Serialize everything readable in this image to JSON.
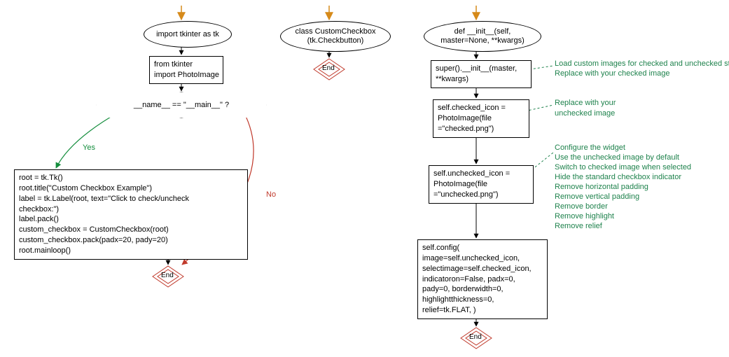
{
  "chart_data": {
    "type": "flowchart",
    "lanes": [
      {
        "id": "main",
        "nodes": [
          {
            "id": "n_import_tk",
            "shape": "ellipse",
            "text": "import tkinter as tk"
          },
          {
            "id": "n_import_photo",
            "shape": "box",
            "text": "from tkinter\nimport PhotoImage"
          },
          {
            "id": "n_main_test",
            "shape": "diamond",
            "text": "__name__ == \"__main__\" ?"
          },
          {
            "id": "n_main_block",
            "shape": "box",
            "text": "root = tk.Tk()\nroot.title(\"Custom Checkbox Example\")\nlabel = tk.Label(root, text=\"Click to check/uncheck\ncheckbox:\")\nlabel.pack()\ncustom_checkbox = CustomCheckbox(root)\ncustom_checkbox.pack(padx=20, pady=20)\nroot.mainloop()"
          },
          {
            "id": "n_end_main",
            "shape": "end",
            "text": "End"
          }
        ],
        "edges": [
          {
            "from": "start",
            "to": "n_import_tk",
            "color": "#d68a1a"
          },
          {
            "from": "n_import_tk",
            "to": "n_import_photo",
            "color": "#000000"
          },
          {
            "from": "n_import_photo",
            "to": "n_main_test",
            "color": "#000000"
          },
          {
            "from": "n_main_test",
            "to": "n_main_block",
            "label": "Yes",
            "color": "#138d3c"
          },
          {
            "from": "n_main_test",
            "to": "n_end_main",
            "label": "No",
            "color": "#c0392b"
          },
          {
            "from": "n_main_block",
            "to": "n_end_main",
            "color": "#000000"
          }
        ]
      },
      {
        "id": "class",
        "nodes": [
          {
            "id": "n_class",
            "shape": "ellipse",
            "text": "class CustomCheckbox\n(tk.Checkbutton)"
          },
          {
            "id": "n_end_class",
            "shape": "end",
            "text": "End"
          }
        ],
        "edges": [
          {
            "from": "start",
            "to": "n_class",
            "color": "#d68a1a"
          },
          {
            "from": "n_class",
            "to": "n_end_class",
            "color": "#000000"
          }
        ]
      },
      {
        "id": "init",
        "nodes": [
          {
            "id": "n_def_init",
            "shape": "ellipse",
            "text": "def __init__(self,\nmaster=None, **kwargs)"
          },
          {
            "id": "n_super",
            "shape": "box",
            "text": "super().__init__(master,\n**kwargs)",
            "comments": [
              "Load custom images for checked and unchecked states",
              "Replace with your checked image"
            ]
          },
          {
            "id": "n_checked",
            "shape": "box",
            "text": "self.checked_icon =\nPhotoImage(file\n=\"checked.png\")",
            "comments": [
              "Replace with your\nunchecked image"
            ]
          },
          {
            "id": "n_unchecked",
            "shape": "box",
            "text": "self.unchecked_icon =\nPhotoImage(file\n=\"unchecked.png\")",
            "comments": [
              "Configure the widget",
              "Use the unchecked image by default",
              "Switch to checked image when selected",
              "Hide the standard checkbox indicator",
              "Remove horizontal padding",
              "Remove vertical padding",
              "Remove border",
              "Remove highlight",
              "Remove relief"
            ]
          },
          {
            "id": "n_config",
            "shape": "box",
            "text": "self.config(\nimage=self.unchecked_icon,\nselectimage=self.checked_icon,\nindicatoron=False, padx=0,\npady=0, borderwidth=0,\nhighlightthickness=0,\nrelief=tk.FLAT, )"
          },
          {
            "id": "n_end_init",
            "shape": "end",
            "text": "End"
          }
        ],
        "edges": [
          {
            "from": "start",
            "to": "n_def_init",
            "color": "#d68a1a"
          },
          {
            "from": "n_def_init",
            "to": "n_super",
            "color": "#000000"
          },
          {
            "from": "n_super",
            "to": "n_checked",
            "color": "#000000"
          },
          {
            "from": "n_checked",
            "to": "n_unchecked",
            "color": "#000000"
          },
          {
            "from": "n_unchecked",
            "to": "n_config",
            "color": "#000000"
          },
          {
            "from": "n_config",
            "to": "n_end_init",
            "color": "#000000"
          }
        ]
      }
    ]
  },
  "labels": {
    "yes": "Yes",
    "no": "No",
    "end": "End"
  }
}
